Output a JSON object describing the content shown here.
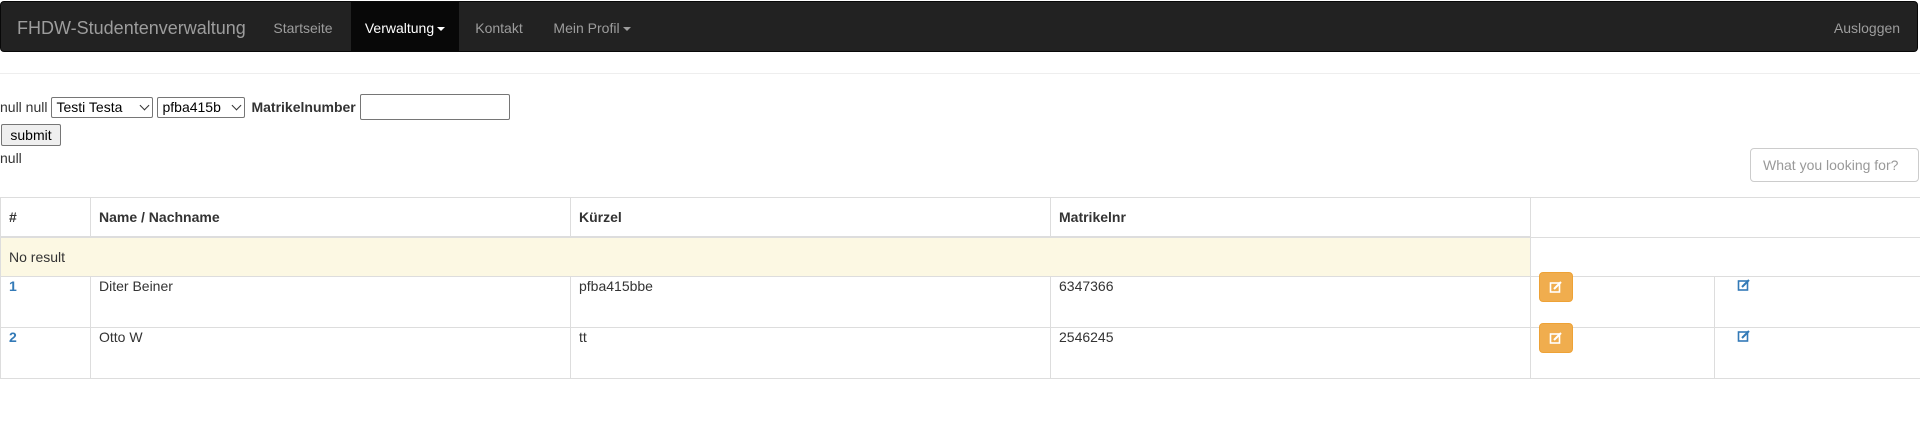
{
  "navbar": {
    "brand": "FHDW-Studentenverwaltung",
    "items": [
      {
        "label": "Startseite",
        "active": false
      },
      {
        "label": "Verwaltung",
        "active": true,
        "dropdown": true
      },
      {
        "label": "Kontakt",
        "active": false
      },
      {
        "label": "Mein Profil",
        "active": false,
        "dropdown": true
      }
    ],
    "logout": "Ausloggen"
  },
  "form": {
    "prefix": "null null",
    "student_select": "Testi Testa",
    "kuerzel_select": "pfba415b",
    "matrikel_label": "Matrikelnumber",
    "matrikel_value": "",
    "submit_label": "submit",
    "result_text": "null"
  },
  "search": {
    "placeholder": "What you looking for?"
  },
  "table": {
    "headers": [
      "#",
      "Name / Nachname",
      "Kürzel",
      "Matrikelnr"
    ],
    "no_result": "No result",
    "rows": [
      {
        "id": "1",
        "name": "Diter Beiner",
        "kuerzel": "pfba415bbe",
        "matrikelnr": "6347366"
      },
      {
        "id": "2",
        "name": "Otto W",
        "kuerzel": "tt",
        "matrikelnr": "2546245"
      }
    ]
  },
  "icons": {
    "edit_button": "edit-icon",
    "edit_link": "edit-link-icon"
  },
  "colors": {
    "navbar_bg": "#222222",
    "navbar_active": "#080808",
    "warning": "#f0ad4e",
    "link": "#337ab7",
    "no_result_bg": "#fcf8e3"
  }
}
